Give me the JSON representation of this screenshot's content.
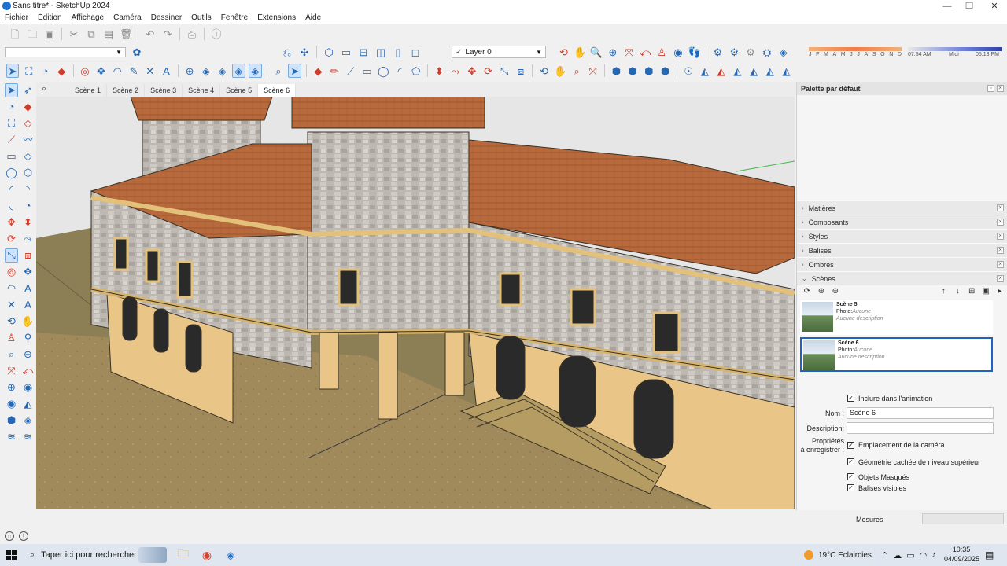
{
  "window": {
    "title": "Sans titre* - SketchUp 2024",
    "minimize": "—",
    "maximize": "❐",
    "close": "✕"
  },
  "menu": [
    "Fichier",
    "Édition",
    "Affichage",
    "Caméra",
    "Dessiner",
    "Outils",
    "Fenêtre",
    "Extensions",
    "Aide"
  ],
  "toolbar": {
    "layer_value": "Layer 0",
    "style_value": "",
    "months": [
      "J",
      "F",
      "M",
      "A",
      "M",
      "J",
      "J",
      "A",
      "S",
      "O",
      "N",
      "D"
    ],
    "time_start": "07:54 AM",
    "time_mid": "Midi",
    "time_end": "05:13 PM"
  },
  "scene_tabs": [
    "Scène 1",
    "Scène 2",
    "Scène 3",
    "Scène 4",
    "Scène 5",
    "Scène 6"
  ],
  "active_scene_tab": "Scène 6",
  "tray": {
    "title": "Palette par défaut",
    "panels": [
      "Matières",
      "Composants",
      "Styles",
      "Balises",
      "Ombres",
      "Scènes"
    ],
    "scenes": [
      {
        "name": "Scène 5",
        "photo_label": "Photo:",
        "photo_value": "Aucune",
        "description": "Aucune description"
      },
      {
        "name": "Scène 6",
        "photo_label": "Photo:",
        "photo_value": "Aucune",
        "description": "Aucune description"
      }
    ],
    "props": {
      "include_anim": "Inclure dans l'animation",
      "name_label": "Nom :",
      "name_value": "Scène 6",
      "desc_label": "Description:",
      "desc_value": "",
      "save_props_label_1": "Propriétés",
      "save_props_label_2": "à enregistrer :",
      "camera": "Emplacement de la caméra",
      "hidden_geometry": "Géométrie cachée de niveau supérieur",
      "hidden_objects": "Objets Masqués",
      "visible_tags": "Balises visibles"
    }
  },
  "measure_label": "Mesures",
  "taskbar": {
    "search_placeholder": "Taper ici pour rechercher",
    "weather": "19°C  Eclaircies",
    "time": "10:35",
    "date": "04/09/2025"
  }
}
